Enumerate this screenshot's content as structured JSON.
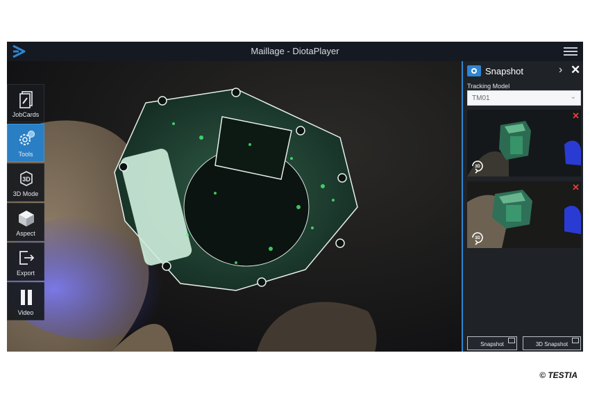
{
  "window": {
    "title": "Maillage - DiotaPlayer"
  },
  "icons": {
    "app_logo": "diota-logo-icon",
    "menu": "hamburger-menu-icon",
    "jobcards": "jobcards-icon",
    "tools": "gear-icon",
    "mode3d": "3d-cube-icon",
    "aspect": "cube-icon",
    "export": "export-icon",
    "video": "pause-icon",
    "snapshot": "camera-icon",
    "next": "chevron-right-icon",
    "close": "close-icon",
    "delete": "delete-x-icon",
    "rotate3d": "rotate-3d-icon"
  },
  "colors": {
    "accent": "#2f86d1",
    "active_tool": "#2a7fc4",
    "fluorescence": "#4dff7a",
    "delete": "#e0413a"
  },
  "toolbar": {
    "items": [
      {
        "label": "JobCards",
        "active": false
      },
      {
        "label": "Tools",
        "active": true
      },
      {
        "label": "3D Mode",
        "active": false
      },
      {
        "label": "Aspect",
        "active": false
      },
      {
        "label": "Export",
        "active": false
      },
      {
        "label": "Video",
        "active": false
      }
    ]
  },
  "panel": {
    "title": "Snapshot",
    "next_glyph": "›",
    "close_glyph": "✕",
    "tracking_label": "Tracking Model",
    "tracking_value": "TM01",
    "tracking_caret": "⌄",
    "snapshots": [
      {
        "badge": "3D",
        "delete_glyph": "✕"
      },
      {
        "badge": "3D",
        "delete_glyph": "✕"
      }
    ],
    "buttons": {
      "snapshot": "Snapshot",
      "snapshot_3d": "3D Snapshot"
    }
  },
  "copyright": "© TESTIA"
}
